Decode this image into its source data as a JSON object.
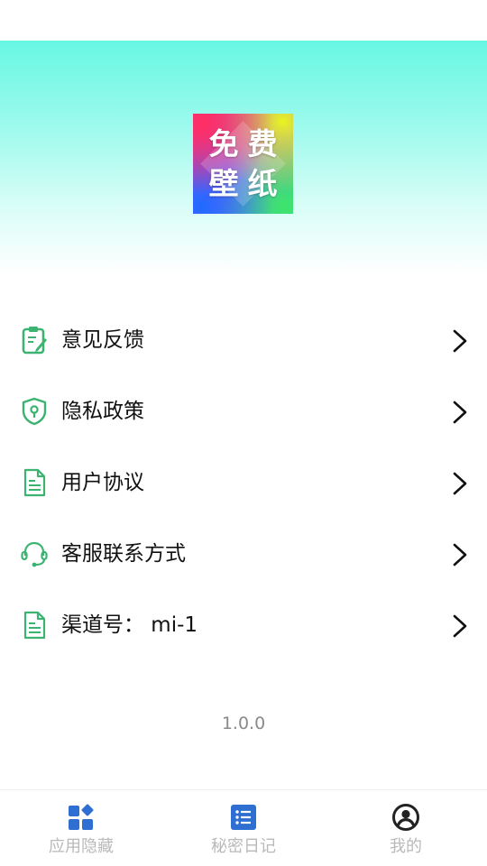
{
  "colors": {
    "accent_green": "#3cb371",
    "tab_blue": "#2f6fd1",
    "tab_active_dark": "#222222",
    "tab_label": "#b9b9b9",
    "version_text": "#8a8a8a",
    "header_top": "#67f7e3"
  },
  "logo": {
    "chars": [
      "免",
      "费",
      "壁",
      "纸"
    ]
  },
  "menu": {
    "items": [
      {
        "label": "意见反馈",
        "icon": "feedback-clipboard-icon"
      },
      {
        "label": "隐私政策",
        "icon": "privacy-shield-icon"
      },
      {
        "label": "用户协议",
        "icon": "user-agreement-document-icon"
      },
      {
        "label": "客服联系方式",
        "icon": "customer-service-headset-icon"
      },
      {
        "label": "渠道号： mi-1",
        "icon": "channel-document-icon"
      }
    ]
  },
  "version": "1.0.0",
  "tabs": [
    {
      "label": "应用隐藏",
      "icon": "apps-grid-icon"
    },
    {
      "label": "秘密日记",
      "icon": "diary-list-icon"
    },
    {
      "label": "我的",
      "icon": "profile-icon",
      "active": true
    }
  ]
}
